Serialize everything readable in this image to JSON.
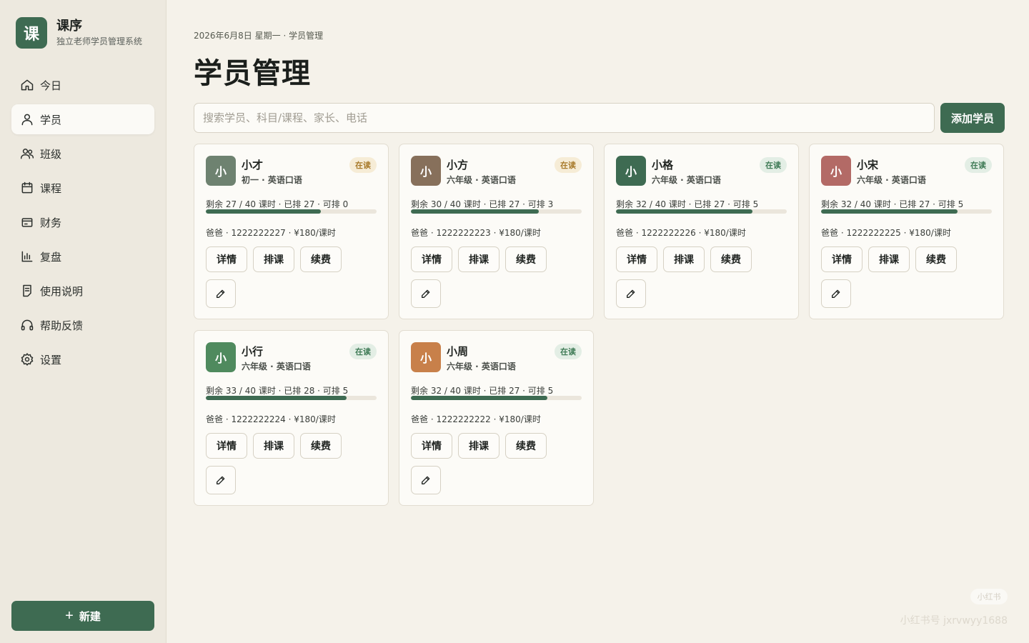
{
  "brand": {
    "logo": "课",
    "title": "课序",
    "subtitle": "独立老师学员管理系统"
  },
  "sidebar": {
    "items": [
      {
        "label": "今日",
        "icon": "home-icon",
        "active": false
      },
      {
        "label": "学员",
        "icon": "user-icon",
        "active": true
      },
      {
        "label": "班级",
        "icon": "users-icon",
        "active": false
      },
      {
        "label": "课程",
        "icon": "calendar-icon",
        "active": false
      },
      {
        "label": "财务",
        "icon": "wallet-icon",
        "active": false
      },
      {
        "label": "复盘",
        "icon": "bar-chart-icon",
        "active": false
      },
      {
        "label": "使用说明",
        "icon": "document-icon",
        "active": false
      },
      {
        "label": "帮助反馈",
        "icon": "headphones-icon",
        "active": false
      },
      {
        "label": "设置",
        "icon": "gear-icon",
        "active": false
      }
    ],
    "new_button": "新建"
  },
  "header": {
    "breadcrumb": "2026年6月8日 星期一 · 学员管理",
    "title": "学员管理"
  },
  "search": {
    "placeholder": "搜索学员、科目/课程、家长、电话",
    "value": ""
  },
  "toolbar": {
    "add_label": "添加学员"
  },
  "actions": {
    "detail": "详情",
    "schedule": "排课",
    "renew": "续费"
  },
  "students": [
    {
      "avatar": "小",
      "avatar_color": "#6e8270",
      "name": "小才",
      "grade": "初一 · 英语口语",
      "status": "在读",
      "status_bg": "#f6ecd6",
      "status_fg": "#a87a2a",
      "hours": "剩余 27 / 40 课时 · 已排 27 · 可排 0",
      "progress": 0.675,
      "contact": "爸爸 · 1222222227 · ¥180/课时"
    },
    {
      "avatar": "小",
      "avatar_color": "#87705b",
      "name": "小方",
      "grade": "六年级 · 英语口语",
      "status": "在读",
      "status_bg": "#f6ecd6",
      "status_fg": "#a87a2a",
      "hours": "剩余 30 / 40 课时 · 已排 27 · 可排 3",
      "progress": 0.75,
      "contact": "爸爸 · 1222222223 · ¥180/课时"
    },
    {
      "avatar": "小",
      "avatar_color": "#3e6b52",
      "name": "小格",
      "grade": "六年级 · 英语口语",
      "status": "在读",
      "status_bg": "#e3eee5",
      "status_fg": "#3e7a55",
      "hours": "剩余 32 / 40 课时 · 已排 27 · 可排 5",
      "progress": 0.8,
      "contact": "爸爸 · 1222222226 · ¥180/课时"
    },
    {
      "avatar": "小",
      "avatar_color": "#b36a66",
      "name": "小宋",
      "grade": "六年级 · 英语口语",
      "status": "在读",
      "status_bg": "#e3eee5",
      "status_fg": "#3e7a55",
      "hours": "剩余 32 / 40 课时 · 已排 27 · 可排 5",
      "progress": 0.8,
      "contact": "爸爸 · 1222222225 · ¥180/课时"
    },
    {
      "avatar": "小",
      "avatar_color": "#4f8a5e",
      "name": "小行",
      "grade": "六年级 · 英语口语",
      "status": "在读",
      "status_bg": "#e3eee5",
      "status_fg": "#3e7a55",
      "hours": "剩余 33 / 40 课时 · 已排 28 · 可排 5",
      "progress": 0.825,
      "contact": "爸爸 · 1222222224 · ¥180/课时"
    },
    {
      "avatar": "小",
      "avatar_color": "#c8804a",
      "name": "小周",
      "grade": "六年级 · 英语口语",
      "status": "在读",
      "status_bg": "#e3eee5",
      "status_fg": "#3e7a55",
      "hours": "剩余 32 / 40 课时 · 已排 27 · 可排 5",
      "progress": 0.8,
      "contact": "爸爸 · 1222222222 · ¥180/课时"
    }
  ],
  "watermark": {
    "badge": "小红书",
    "text": "小红书号 jxrvwyy1688"
  }
}
